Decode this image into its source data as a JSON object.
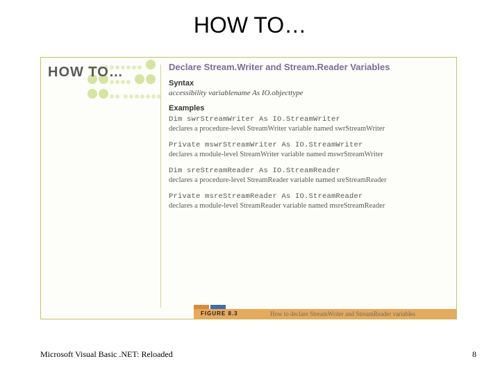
{
  "title": "HOW TO…",
  "howto_label": "HOW TO…",
  "section_title": "Declare Stream.Writer and Stream.Reader Variables",
  "syntax_head": "Syntax",
  "syntax_line": "accessibility variablename As IO.objecttype",
  "examples_head": "Examples",
  "examples": [
    {
      "code": "Dim swrStreamWriter As IO.StreamWriter",
      "desc": "declares a procedure-level StreamWriter variable named swrStreamWriter"
    },
    {
      "code": "Private mswrStreamWriter As IO.StreamWriter",
      "desc": "declares a module-level StreamWriter variable named mswrStreamWriter"
    },
    {
      "code": "Dim sreStreamReader As IO.StreamReader",
      "desc": "declares a procedure-level StreamReader variable named sreStreamReader"
    },
    {
      "code": "Private msreStreamReader As IO.StreamReader",
      "desc": "declares a module-level StreamReader variable named msreStreamReader"
    }
  ],
  "figure": {
    "label": "FIGURE 8.3",
    "caption": "How to declare StreamWriter and StreamReader variables"
  },
  "footer": {
    "left": "Microsoft Visual Basic .NET: Reloaded",
    "page": "8"
  }
}
